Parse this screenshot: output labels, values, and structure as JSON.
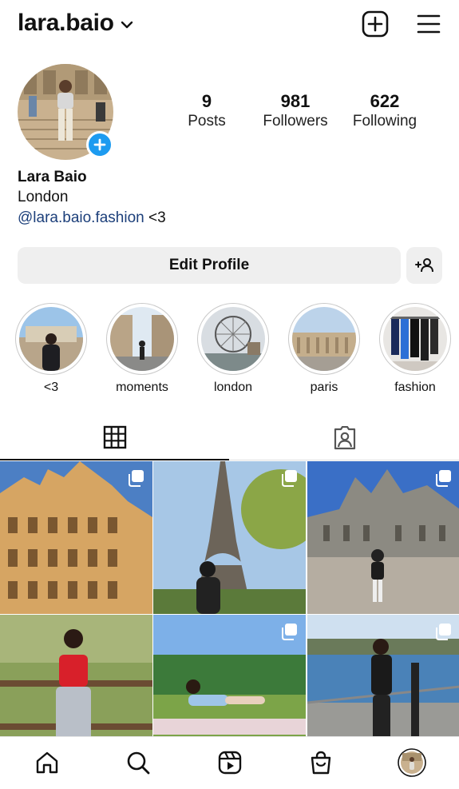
{
  "header": {
    "username": "lara.baio",
    "icons": [
      "chevron-down-icon",
      "new-post-icon",
      "menu-icon"
    ]
  },
  "profile": {
    "stats": [
      {
        "count": "9",
        "label": "Posts"
      },
      {
        "count": "981",
        "label": "Followers"
      },
      {
        "count": "622",
        "label": "Following"
      }
    ],
    "name": "Lara Baio",
    "location": "London",
    "bio_link": "@lara.baio.fashion",
    "bio_suffix": " <3"
  },
  "actions": {
    "edit_label": "Edit Profile",
    "add_person_icon": "add-person-icon"
  },
  "highlights": [
    {
      "label": "<3"
    },
    {
      "label": "moments"
    },
    {
      "label": "london"
    },
    {
      "label": "paris"
    },
    {
      "label": "fashion"
    }
  ],
  "tabs": [
    {
      "icon": "grid-icon",
      "active": true
    },
    {
      "icon": "tagged-icon",
      "active": false
    }
  ],
  "posts": [
    {
      "scene": "chateau",
      "multi": true
    },
    {
      "scene": "eiffel",
      "multi": true
    },
    {
      "scene": "museum",
      "multi": true
    },
    {
      "scene": "red-top",
      "multi": false
    },
    {
      "scene": "park",
      "multi": true
    },
    {
      "scene": "seaside",
      "multi": true
    }
  ],
  "bottom_nav": [
    "home-icon",
    "search-icon",
    "reels-icon",
    "shop-icon",
    "profile-avatar"
  ],
  "colors": {
    "accent": "#1d9bf0",
    "link": "#1c3f7a",
    "button_bg": "#efefef"
  }
}
